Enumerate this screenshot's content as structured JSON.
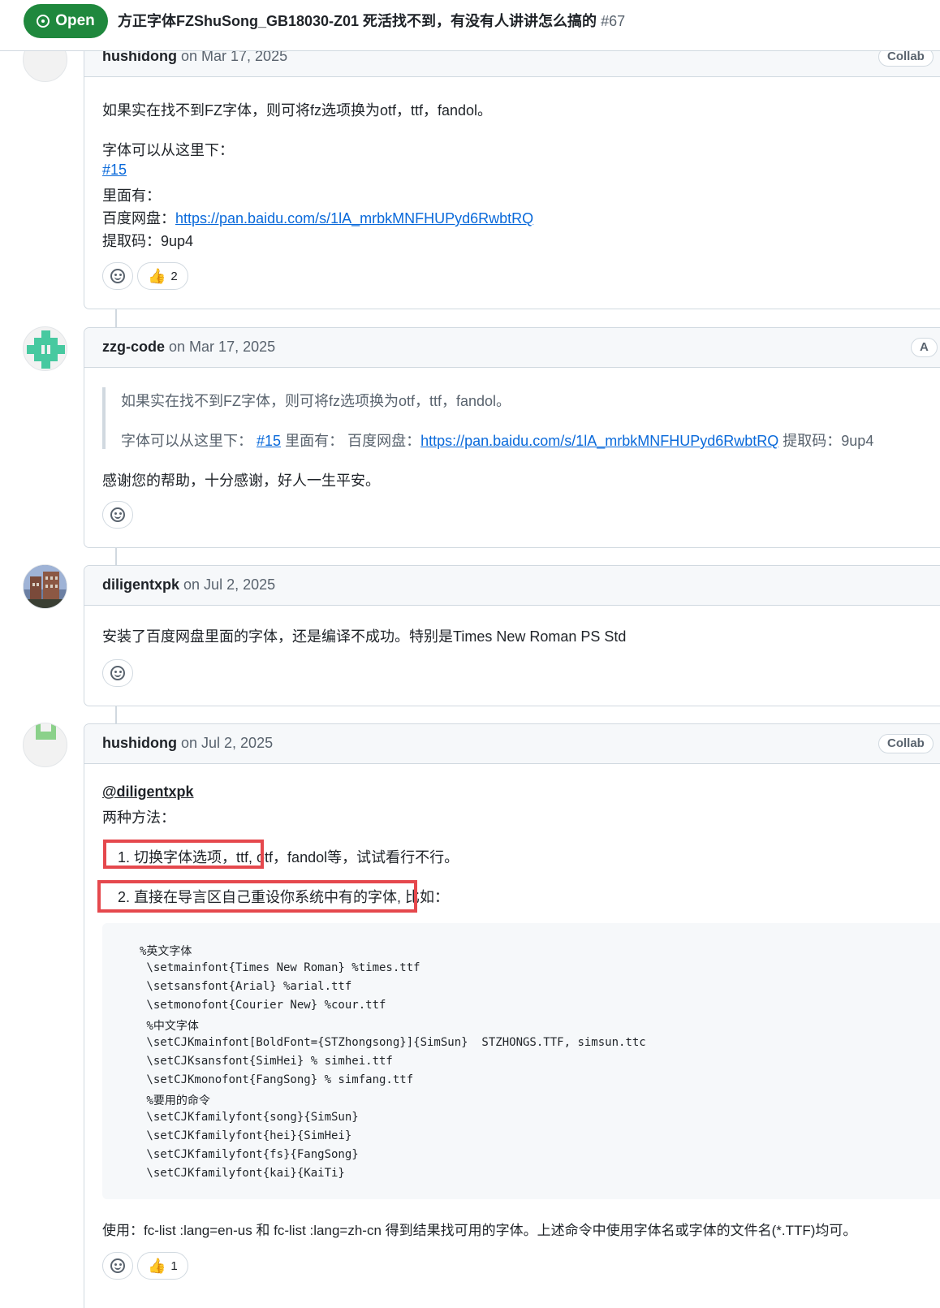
{
  "header": {
    "state_label": "Open",
    "issue_title": "方正字体FZShuSong_GB18030-Z01 死活找不到，有没有人讲讲怎么搞的",
    "issue_number": "#67"
  },
  "comments": [
    {
      "author": "hushidong",
      "date": "on Mar 17, 2025",
      "role": "Collab",
      "lines": [
        "如果实在找不到FZ字体，则可将fz选项换为otf，ttf，fandol。",
        "字体可以从这里下：",
        "里面有：",
        "提取码：9up4"
      ],
      "issue_link": "#15",
      "pan_prefix": "百度网盘：",
      "pan_link": "https://pan.baidu.com/s/1lA_mrbkMNFHUPyd6RwbtRQ",
      "thumbs_count": "2"
    },
    {
      "author": "zzg-code",
      "date": "on Mar 17, 2025",
      "role": "A",
      "quote_line1": "如果实在找不到FZ字体，则可将fz选项换为otf，ttf，fandol。",
      "quote_prefix": "字体可以从这里下：",
      "quote_issue_link": "#15",
      "quote_mid": "里面有： 百度网盘：",
      "quote_pan_link": "https://pan.baidu.com/s/1lA_mrbkMNFHUPyd6RwbtRQ",
      "quote_suffix": "提取码：9up4",
      "body_line": "感谢您的帮助，十分感谢，好人一生平安。"
    },
    {
      "author": "diligentxpk",
      "date": "on Jul 2, 2025",
      "body_line": "安装了百度网盘里面的字体，还是编译不成功。特别是Times New Roman PS Std"
    },
    {
      "author": "hushidong",
      "date": "on Jul 2, 2025",
      "role": "Collab",
      "mention": "@diligentxpk",
      "intro": "两种方法：",
      "item1_boxed": "1. 切换字体选项，ttf,",
      "item1_rest": "otf，fandol等，试试看行不行。",
      "item2_boxed": "2. 直接在导言区自己重设你系统中有的字体,",
      "item2_rest": "比如：",
      "code_lines": [
        "%英文字体",
        " \\setmainfont{Times New Roman} %times.ttf",
        " \\setsansfont{Arial} %arial.ttf",
        " \\setmonofont{Courier New} %cour.ttf",
        " %中文字体",
        " \\setCJKmainfont[BoldFont={STZhongsong}]{SimSun}  STZHONGS.TTF, simsun.ttc",
        " \\setCJKsansfont{SimHei} % simhei.ttf",
        " \\setCJKmonofont{FangSong} % simfang.ttf",
        " %要用的命令",
        " \\setCJKfamilyfont{song}{SimSun}",
        " \\setCJKfamilyfont{hei}{SimHei}",
        " \\setCJKfamilyfont{fs}{FangSong}",
        " \\setCJKfamilyfont{kai}{KaiTi}"
      ],
      "usage": "使用：fc-list :lang=en-us 和 fc-list :lang=zh-cn 得到结果找可用的字体。上述命令中使用字体名或字体的文件名(*.TTF)均可。",
      "thumbs_count": "1"
    }
  ],
  "icons": [
    "issue-open-icon",
    "smiley-icon",
    "thumbs-up-icon"
  ],
  "colors": {
    "open_green": "#1f883d",
    "link_blue": "#0969da",
    "highlight_red": "#e5484d"
  }
}
